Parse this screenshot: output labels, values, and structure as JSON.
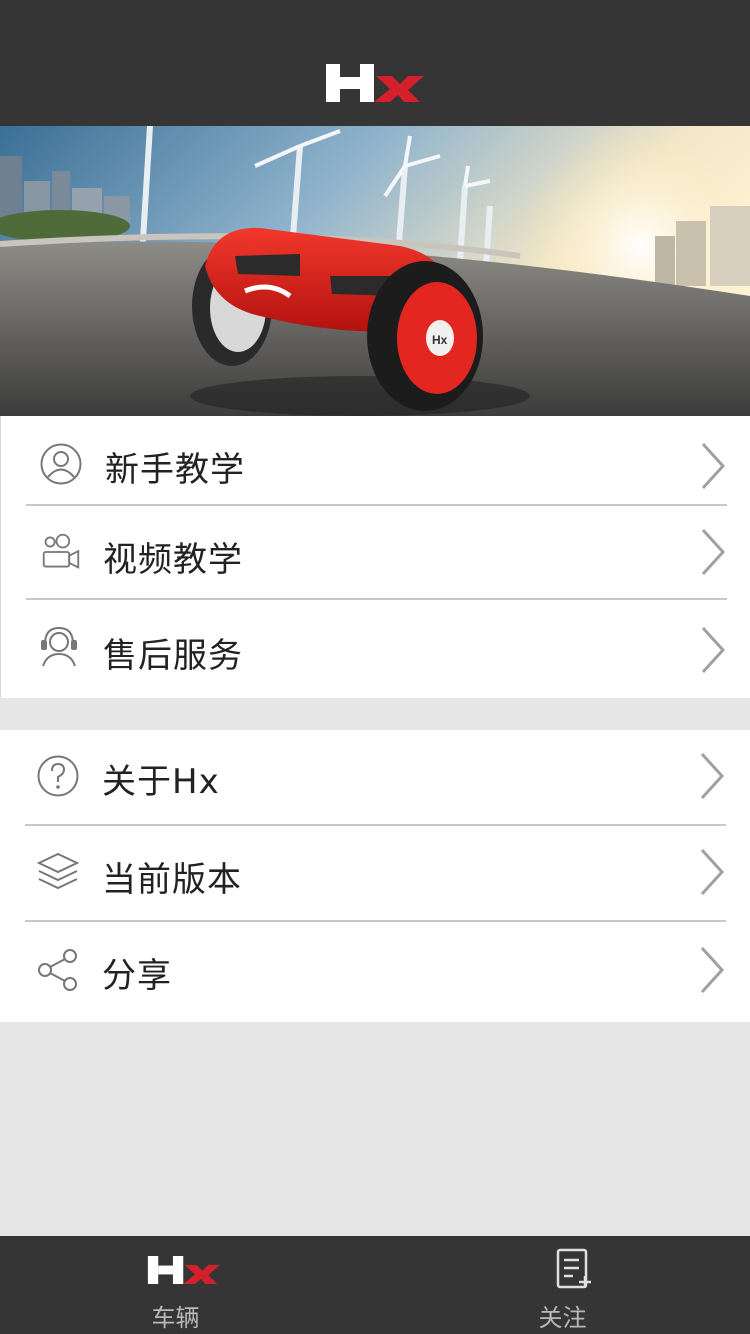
{
  "header": {
    "logo_icon": "hx-logo-icon"
  },
  "banner": {
    "image": "red-hoverboard-on-road-with-wind-turbines"
  },
  "menu_group_1": [
    {
      "label": "新手教学",
      "icon": "user-circle-icon"
    },
    {
      "label": "视频教学",
      "icon": "video-camera-icon"
    },
    {
      "label": "售后服务",
      "icon": "headset-support-icon"
    }
  ],
  "menu_group_2": [
    {
      "label": "关于Hx",
      "icon": "question-circle-icon"
    },
    {
      "label": "当前版本",
      "icon": "layers-icon"
    },
    {
      "label": "分享",
      "icon": "share-icon"
    }
  ],
  "tabbar": {
    "tabs": [
      {
        "label": "车辆",
        "icon": "hx-logo-icon"
      },
      {
        "label": "关注",
        "icon": "document-add-icon"
      }
    ]
  },
  "colors": {
    "dark_bar": "#353535",
    "brand_red": "#d4202a",
    "page_bg": "#e6e6e6"
  }
}
